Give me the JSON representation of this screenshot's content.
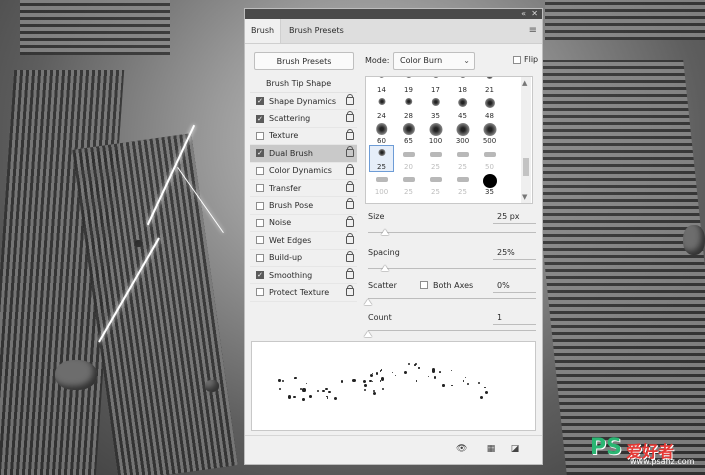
{
  "panel": {
    "tabs": [
      "Brush",
      "Brush Presets"
    ],
    "brush_presets_button": "Brush Presets",
    "mode_label": "Mode:",
    "mode_value": "Color Burn",
    "flip_label": "Flip",
    "tip_shape_label": "Brush Tip Shape",
    "options": [
      {
        "label": "Shape Dynamics",
        "checked": true
      },
      {
        "label": "Scattering",
        "checked": true
      },
      {
        "label": "Texture",
        "checked": false
      },
      {
        "label": "Dual Brush",
        "checked": true
      },
      {
        "label": "Color Dynamics",
        "checked": false
      },
      {
        "label": "Transfer",
        "checked": false
      },
      {
        "label": "Brush Pose",
        "checked": false
      },
      {
        "label": "Noise",
        "checked": false
      },
      {
        "label": "Wet Edges",
        "checked": false
      },
      {
        "label": "Build-up",
        "checked": false
      },
      {
        "label": "Smoothing",
        "checked": true
      },
      {
        "label": "Protect Texture",
        "checked": false
      }
    ],
    "selected_option": "Dual Brush",
    "brush_sizes": [
      "14",
      "19",
      "17",
      "18",
      "21",
      "24",
      "28",
      "35",
      "45",
      "48",
      "60",
      "65",
      "100",
      "300",
      "500",
      "25",
      "20",
      "25",
      "25",
      "50",
      "100",
      "25",
      "25",
      "25",
      "35"
    ],
    "size": {
      "label": "Size",
      "value": "25 px"
    },
    "spacing": {
      "label": "Spacing",
      "value": "25%",
      "checked": true
    },
    "scatter": {
      "label": "Scatter",
      "both_axes_label": "Both Axes",
      "value": "0%"
    },
    "count": {
      "label": "Count",
      "value": "1"
    },
    "slider_levels": {
      "size": 0.1,
      "spacing": 0.1,
      "scatter": 0.0,
      "count": 0.0
    }
  },
  "watermark": {
    "logo": "PS",
    "brand": "爱好者",
    "url": "www.psahz.com"
  }
}
